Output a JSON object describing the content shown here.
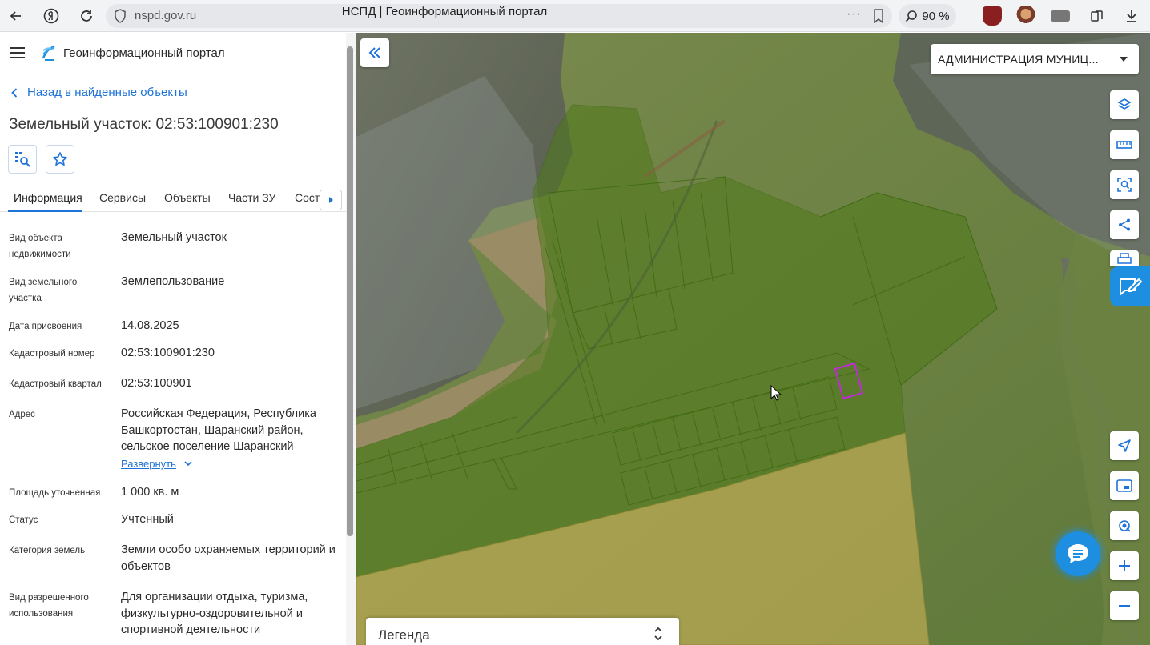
{
  "browser": {
    "url": "nspd.gov.ru",
    "tab_title": "НСПД | Геоинформационный портал",
    "dots": "···",
    "zoom": "90 %"
  },
  "header": {
    "portal_title": "Геоинформационный портал"
  },
  "nav": {
    "back_label": "Назад в найденные объекты"
  },
  "object": {
    "title": "Земельный участок: 02:53:100901:230"
  },
  "tabs": [
    {
      "label": "Информация"
    },
    {
      "label": "Сервисы"
    },
    {
      "label": "Объекты"
    },
    {
      "label": "Части ЗУ"
    },
    {
      "label": "Соста"
    }
  ],
  "info": {
    "rows": [
      {
        "label": "Вид объекта недвижимости",
        "value": "Земельный участок"
      },
      {
        "label": "Вид земельного участка",
        "value": "Землепользование"
      },
      {
        "label": "Дата присвоения",
        "value": "14.08.2025"
      },
      {
        "label": "Кадастровый номер",
        "value": "02:53:100901:230"
      },
      {
        "label": "Кадастровый квартал",
        "value": "02:53:100901"
      },
      {
        "label": "Адрес",
        "value": "Российская Федерация, Республика Башкортостан, Шаранский район, сельское поселение Шаранский"
      },
      {
        "label": "Площадь уточненная",
        "value": "1 000 кв. м"
      },
      {
        "label": "Статус",
        "value": "Учтенный"
      },
      {
        "label": "Категория земель",
        "value": "Земли особо охраняемых территорий и объектов"
      },
      {
        "label": "Вид разрешенного использования",
        "value": "Для организации отдыха, туризма, физкультурно-оздоровительной и спортивной деятельности"
      }
    ],
    "expand_label": "Развернуть"
  },
  "map": {
    "admin_select_value": "АДМИНИСТРАЦИЯ МУНИЦ...",
    "legend_title": "Легенда",
    "tools": [
      "layers-icon",
      "ruler-icon",
      "select-area-icon",
      "share-icon",
      "print-icon",
      "navigate-icon",
      "minimap-icon",
      "locate-icon",
      "zoom-in-icon",
      "zoom-out-icon"
    ]
  },
  "colors": {
    "accent": "#1e73d8",
    "feedback": "#1e8ee0",
    "parcel_green": "#6b8f1e",
    "parcel_yellow": "#d6b85a",
    "selected_parcel": "#c02bd6"
  }
}
